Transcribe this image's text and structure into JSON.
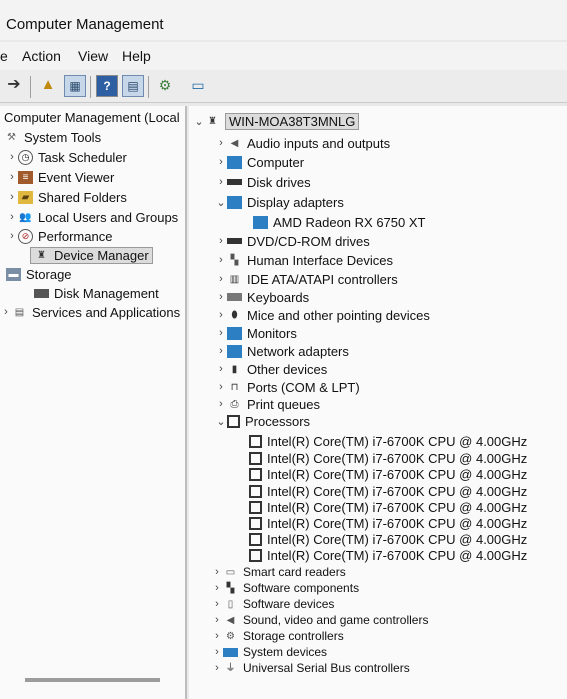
{
  "window": {
    "title": "Computer Management"
  },
  "menu": {
    "file_fragment": "e",
    "action": "Action",
    "view": "View",
    "help": "Help"
  },
  "left_tree": {
    "root": "Computer Management (Local",
    "system_tools": "System Tools",
    "task_scheduler": "Task Scheduler",
    "event_viewer": "Event Viewer",
    "shared_folders": "Shared Folders",
    "local_users": "Local Users and Groups",
    "performance": "Performance",
    "device_manager": "Device Manager",
    "storage": "Storage",
    "disk_management": "Disk Management",
    "services": "Services and Applications"
  },
  "device_tree": {
    "root": "WIN-MOA38T3MNLG",
    "audio": "Audio inputs and outputs",
    "computer": "Computer",
    "disk_drives": "Disk drives",
    "display_adapters": "Display adapters",
    "gpu": "AMD Radeon RX 6750 XT",
    "dvd": "DVD/CD-ROM drives",
    "hid": "Human Interface Devices",
    "ide": "IDE ATA/ATAPI controllers",
    "keyboards": "Keyboards",
    "mice": "Mice and other pointing devices",
    "monitors": "Monitors",
    "network": "Network adapters",
    "other": "Other devices",
    "ports": "Ports (COM & LPT)",
    "print_queues": "Print queues",
    "processors": "Processors",
    "cpus": [
      "Intel(R) Core(TM) i7-6700K CPU @ 4.00GHz",
      "Intel(R) Core(TM) i7-6700K CPU @ 4.00GHz",
      "Intel(R) Core(TM) i7-6700K CPU @ 4.00GHz",
      "Intel(R) Core(TM) i7-6700K CPU @ 4.00GHz",
      "Intel(R) Core(TM) i7-6700K CPU @ 4.00GHz",
      "Intel(R) Core(TM) i7-6700K CPU @ 4.00GHz",
      "Intel(R) Core(TM) i7-6700K CPU @ 4.00GHz",
      "Intel(R) Core(TM) i7-6700K CPU @ 4.00GHz"
    ],
    "smart_card": "Smart card readers",
    "software_components": "Software components",
    "software_devices": "Software devices",
    "sound": "Sound, video and game controllers",
    "storage_controllers": "Storage controllers",
    "system_devices": "System devices",
    "usb": "Universal Serial Bus controllers"
  },
  "icons": {
    "back": "arrow-icon",
    "folder": "folder-icon",
    "console": "console-icon",
    "help": "help-icon",
    "properties": "properties-icon",
    "scan": "scan-hardware-icon",
    "monitor": "monitor-icon"
  }
}
